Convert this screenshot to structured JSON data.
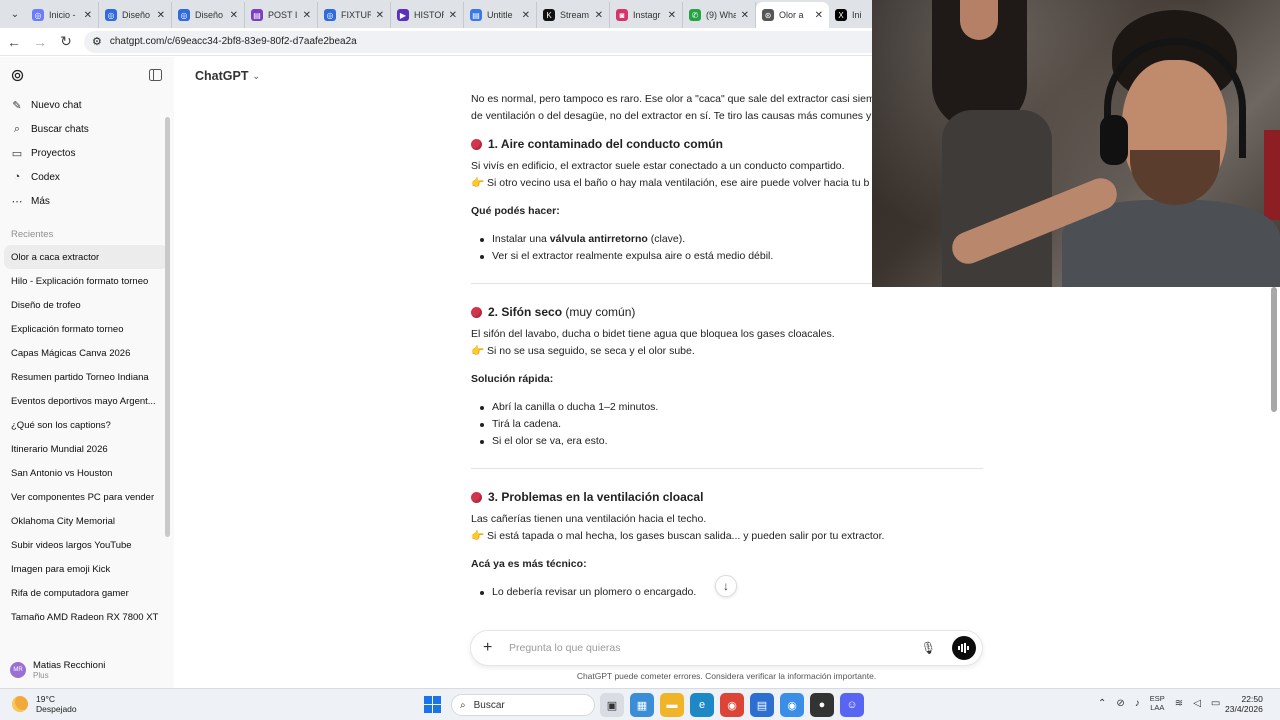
{
  "browser": {
    "tabs": [
      {
        "label": "Inicio -",
        "color": "#6b7cff",
        "glyph": "◎"
      },
      {
        "label": "Diseño",
        "color": "#2f6bde",
        "glyph": "◎"
      },
      {
        "label": "Diseño",
        "color": "#2f6bde",
        "glyph": "◎"
      },
      {
        "label": "POST II",
        "color": "#7b3fbf",
        "glyph": "▤"
      },
      {
        "label": "FIXTUR",
        "color": "#2f6bde",
        "glyph": "◎"
      },
      {
        "label": "HISTOR",
        "color": "#5b2fbf",
        "glyph": "▶"
      },
      {
        "label": "Untitle",
        "color": "#3b78e7",
        "glyph": "▤"
      },
      {
        "label": "Stream",
        "color": "#111111",
        "glyph": "K"
      },
      {
        "label": "Instagr",
        "color": "#d6336c",
        "glyph": "◙"
      },
      {
        "label": "(9) Wha",
        "color": "#25a244",
        "glyph": "✆"
      },
      {
        "label": "Olor a",
        "color": "#555555",
        "glyph": "⊛"
      },
      {
        "label": "Ini",
        "color": "#000000",
        "glyph": "X"
      }
    ],
    "url": "chatgpt.com/c/69eacc34-2bf8-83e9-80f2-d7aafe2bea2a"
  },
  "sidebar": {
    "nav": [
      {
        "label": "Nuevo chat",
        "icon": "✎"
      },
      {
        "label": "Buscar chats",
        "icon": "⌕"
      },
      {
        "label": "Proyectos",
        "icon": "▭"
      },
      {
        "label": "Codex",
        "icon": "◔"
      },
      {
        "label": "Más",
        "icon": "⋯"
      }
    ],
    "section_label": "Recientes",
    "chats": [
      "Olor a caca extractor",
      "Hilo - Explicación formato torneo",
      "Diseño de trofeo",
      "Explicación formato torneo",
      "Capas Mágicas Canva 2026",
      "Resumen partido Torneo Indiana",
      "Eventos deportivos mayo Argent...",
      "¿Qué son los captions?",
      "Itinerario Mundial 2026",
      "San Antonio vs Houston",
      "Ver componentes PC para vender",
      "Oklahoma City Memorial",
      "Subir videos largos YouTube",
      "Imagen para emoji Kick",
      "Rifa de computadora gamer",
      "Tamaño AMD Radeon RX 7800 XT"
    ],
    "user": {
      "name": "Matias Recchioni",
      "plan": "Plus",
      "initials": "MR"
    }
  },
  "main": {
    "model": "ChatGPT",
    "intro_1": "No es normal, pero tampoco es raro. Ese olor a \"caca\" que sale del extractor casi siem",
    "intro_2": "de ventilación o del desagüe, no del extractor en sí. Te tiro las causas más comunes y",
    "s1": {
      "title_bold": "1. Aire contaminado del conducto común",
      "l1": "Si vivís en edificio, el extractor suele estar conectado a un conducto compartido.",
      "l2": "👉 Si otro vecino usa el baño o hay mala ventilación, ese aire puede volver hacia tu b",
      "sub": "Qué podés hacer:",
      "b1_pre": "Instalar una ",
      "b1_bold": "válvula antirretorno",
      "b1_post": " (clave).",
      "b2": "Ver si el extractor realmente expulsa aire o está medio débil."
    },
    "s2": {
      "title_bold": "2. Sifón seco",
      "title_rest": " (muy común)",
      "l1": "El sifón del lavabo, ducha o bidet tiene agua que bloquea los gases cloacales.",
      "l2": "👉 Si no se usa seguido, se seca y el olor sube.",
      "sub": "Solución rápida:",
      "b1": "Abrí la canilla o ducha 1–2 minutos.",
      "b2": "Tirá la cadena.",
      "b3": "Si el olor se va, era esto."
    },
    "s3": {
      "title_bold": "3. Problemas en la ventilación cloacal",
      "l1": "Las cañerías tienen una ventilación hacia el techo.",
      "l2": "👉 Si está tapada o mal hecha, los gases buscan salida... y pueden salir por tu extractor.",
      "sub": "Acá ya es más técnico:",
      "b1": "Lo debería revisar un plomero o encargado."
    },
    "composer_placeholder": "Pregunta lo que quieras",
    "disclaimer": "ChatGPT puede cometer errores. Considera verificar la información importante."
  },
  "taskbar": {
    "temp": "19°C",
    "weather": "Despejado",
    "search": "Buscar",
    "lang_1": "ESP",
    "lang_2": "LAA",
    "time": "22:50",
    "date": "23/4/2026"
  },
  "colors": {
    "accent": "#d2334d",
    "sidebar_bg": "#f9f9f9",
    "taskbar_bg": "#eef1f5"
  }
}
